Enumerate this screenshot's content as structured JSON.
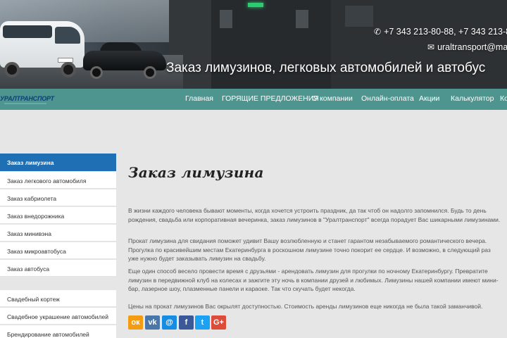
{
  "header": {
    "phone": "+7 343 213-80-88, +7 343 213-8",
    "email": "uraltransport@ma",
    "slogan": "Заказ лимузинов, легковых автомобилей и автобус"
  },
  "logo": {
    "text": "УРАЛТРАНСПОРТ"
  },
  "nav": {
    "items": [
      {
        "label": "Главная"
      },
      {
        "label": "ГОРЯЩИЕ ПРЕДЛОЖЕНИЯ"
      },
      {
        "label": "О компании"
      },
      {
        "label": "Онлайн-оплата"
      },
      {
        "label": "Акции"
      },
      {
        "label": "Калькулятор"
      },
      {
        "label": "Ко"
      }
    ]
  },
  "sidebar": {
    "items": [
      {
        "label": "Заказ лимузина",
        "active": true
      },
      {
        "label": "Заказ легкового автомобиля"
      },
      {
        "label": "Заказ кабриолета"
      },
      {
        "label": "Заказ внедорожника"
      },
      {
        "label": "Заказ минивэна"
      },
      {
        "label": "Заказ микроавтобуса"
      },
      {
        "label": "Заказ автобуса"
      },
      {
        "label": "Свадебный кортеж"
      },
      {
        "label": "Свадебное украшение автомобилей"
      },
      {
        "label": "Брендирование автомобилей"
      }
    ]
  },
  "main": {
    "title": "Заказ лимузина",
    "paragraphs": [
      "В жизни каждого человека бывают моменты, когда хочется устроить праздник, да так чтоб он надолго запомнился. Будь то день рождения, свадьба или корпоративная вечеринка, заказ лимузинов в \"Уралтранспорт\" всегда порадует Вас шикарными лимузинами.",
      "Прокат лимузина для свидания поможет удивит Вашу возлюбленную и станет гарантом незабываемого романтического вечера. Прогулка по красивейшим местам Екатеринбурга в роскошном лимузине точно покорит ее сердце. И возможно, в следующий раз уже нужно будет заказывать лимузин на свадьбу.",
      "Еще один способ весело провести время с друзьями - арендовать лимузин для прогулки по ночному Екатеринбургу. Превратите лимузин в передвижной клуб на колесах и зажгите эту ночь в компании друзей и любимых. Лимузины нашей компании имеют мини-бар, лазерное шоу, плазменные панели и караоке. Так что скучать будет некогда.",
      "Цены на прокат лимузинов Вас окрылят доступностью. Стоимость аренды лимузинов еще никогда не была такой заманчивой."
    ]
  },
  "social": [
    {
      "name": "odnoklassniki",
      "glyph": "ок",
      "color": "#f39c12"
    },
    {
      "name": "vkontakte",
      "glyph": "vk",
      "color": "#4a76a8"
    },
    {
      "name": "mailru",
      "glyph": "@",
      "color": "#168de2"
    },
    {
      "name": "facebook",
      "glyph": "f",
      "color": "#3b5998"
    },
    {
      "name": "twitter",
      "glyph": "t",
      "color": "#1da1f2"
    },
    {
      "name": "googleplus",
      "glyph": "G+",
      "color": "#dd4b39"
    }
  ]
}
